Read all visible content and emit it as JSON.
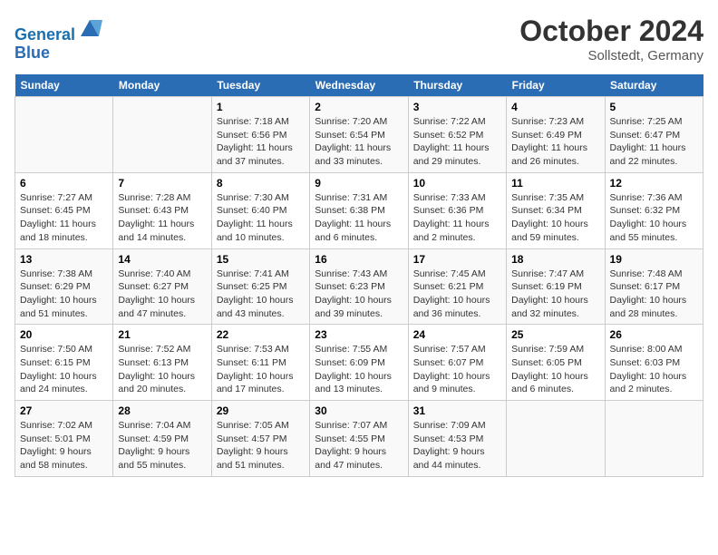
{
  "header": {
    "logo_line1": "General",
    "logo_line2": "Blue",
    "month": "October 2024",
    "location": "Sollstedt, Germany"
  },
  "weekdays": [
    "Sunday",
    "Monday",
    "Tuesday",
    "Wednesday",
    "Thursday",
    "Friday",
    "Saturday"
  ],
  "weeks": [
    [
      {
        "day": "",
        "detail": ""
      },
      {
        "day": "",
        "detail": ""
      },
      {
        "day": "1",
        "detail": "Sunrise: 7:18 AM\nSunset: 6:56 PM\nDaylight: 11 hours and 37 minutes."
      },
      {
        "day": "2",
        "detail": "Sunrise: 7:20 AM\nSunset: 6:54 PM\nDaylight: 11 hours and 33 minutes."
      },
      {
        "day": "3",
        "detail": "Sunrise: 7:22 AM\nSunset: 6:52 PM\nDaylight: 11 hours and 29 minutes."
      },
      {
        "day": "4",
        "detail": "Sunrise: 7:23 AM\nSunset: 6:49 PM\nDaylight: 11 hours and 26 minutes."
      },
      {
        "day": "5",
        "detail": "Sunrise: 7:25 AM\nSunset: 6:47 PM\nDaylight: 11 hours and 22 minutes."
      }
    ],
    [
      {
        "day": "6",
        "detail": "Sunrise: 7:27 AM\nSunset: 6:45 PM\nDaylight: 11 hours and 18 minutes."
      },
      {
        "day": "7",
        "detail": "Sunrise: 7:28 AM\nSunset: 6:43 PM\nDaylight: 11 hours and 14 minutes."
      },
      {
        "day": "8",
        "detail": "Sunrise: 7:30 AM\nSunset: 6:40 PM\nDaylight: 11 hours and 10 minutes."
      },
      {
        "day": "9",
        "detail": "Sunrise: 7:31 AM\nSunset: 6:38 PM\nDaylight: 11 hours and 6 minutes."
      },
      {
        "day": "10",
        "detail": "Sunrise: 7:33 AM\nSunset: 6:36 PM\nDaylight: 11 hours and 2 minutes."
      },
      {
        "day": "11",
        "detail": "Sunrise: 7:35 AM\nSunset: 6:34 PM\nDaylight: 10 hours and 59 minutes."
      },
      {
        "day": "12",
        "detail": "Sunrise: 7:36 AM\nSunset: 6:32 PM\nDaylight: 10 hours and 55 minutes."
      }
    ],
    [
      {
        "day": "13",
        "detail": "Sunrise: 7:38 AM\nSunset: 6:29 PM\nDaylight: 10 hours and 51 minutes."
      },
      {
        "day": "14",
        "detail": "Sunrise: 7:40 AM\nSunset: 6:27 PM\nDaylight: 10 hours and 47 minutes."
      },
      {
        "day": "15",
        "detail": "Sunrise: 7:41 AM\nSunset: 6:25 PM\nDaylight: 10 hours and 43 minutes."
      },
      {
        "day": "16",
        "detail": "Sunrise: 7:43 AM\nSunset: 6:23 PM\nDaylight: 10 hours and 39 minutes."
      },
      {
        "day": "17",
        "detail": "Sunrise: 7:45 AM\nSunset: 6:21 PM\nDaylight: 10 hours and 36 minutes."
      },
      {
        "day": "18",
        "detail": "Sunrise: 7:47 AM\nSunset: 6:19 PM\nDaylight: 10 hours and 32 minutes."
      },
      {
        "day": "19",
        "detail": "Sunrise: 7:48 AM\nSunset: 6:17 PM\nDaylight: 10 hours and 28 minutes."
      }
    ],
    [
      {
        "day": "20",
        "detail": "Sunrise: 7:50 AM\nSunset: 6:15 PM\nDaylight: 10 hours and 24 minutes."
      },
      {
        "day": "21",
        "detail": "Sunrise: 7:52 AM\nSunset: 6:13 PM\nDaylight: 10 hours and 20 minutes."
      },
      {
        "day": "22",
        "detail": "Sunrise: 7:53 AM\nSunset: 6:11 PM\nDaylight: 10 hours and 17 minutes."
      },
      {
        "day": "23",
        "detail": "Sunrise: 7:55 AM\nSunset: 6:09 PM\nDaylight: 10 hours and 13 minutes."
      },
      {
        "day": "24",
        "detail": "Sunrise: 7:57 AM\nSunset: 6:07 PM\nDaylight: 10 hours and 9 minutes."
      },
      {
        "day": "25",
        "detail": "Sunrise: 7:59 AM\nSunset: 6:05 PM\nDaylight: 10 hours and 6 minutes."
      },
      {
        "day": "26",
        "detail": "Sunrise: 8:00 AM\nSunset: 6:03 PM\nDaylight: 10 hours and 2 minutes."
      }
    ],
    [
      {
        "day": "27",
        "detail": "Sunrise: 7:02 AM\nSunset: 5:01 PM\nDaylight: 9 hours and 58 minutes."
      },
      {
        "day": "28",
        "detail": "Sunrise: 7:04 AM\nSunset: 4:59 PM\nDaylight: 9 hours and 55 minutes."
      },
      {
        "day": "29",
        "detail": "Sunrise: 7:05 AM\nSunset: 4:57 PM\nDaylight: 9 hours and 51 minutes."
      },
      {
        "day": "30",
        "detail": "Sunrise: 7:07 AM\nSunset: 4:55 PM\nDaylight: 9 hours and 47 minutes."
      },
      {
        "day": "31",
        "detail": "Sunrise: 7:09 AM\nSunset: 4:53 PM\nDaylight: 9 hours and 44 minutes."
      },
      {
        "day": "",
        "detail": ""
      },
      {
        "day": "",
        "detail": ""
      }
    ]
  ]
}
